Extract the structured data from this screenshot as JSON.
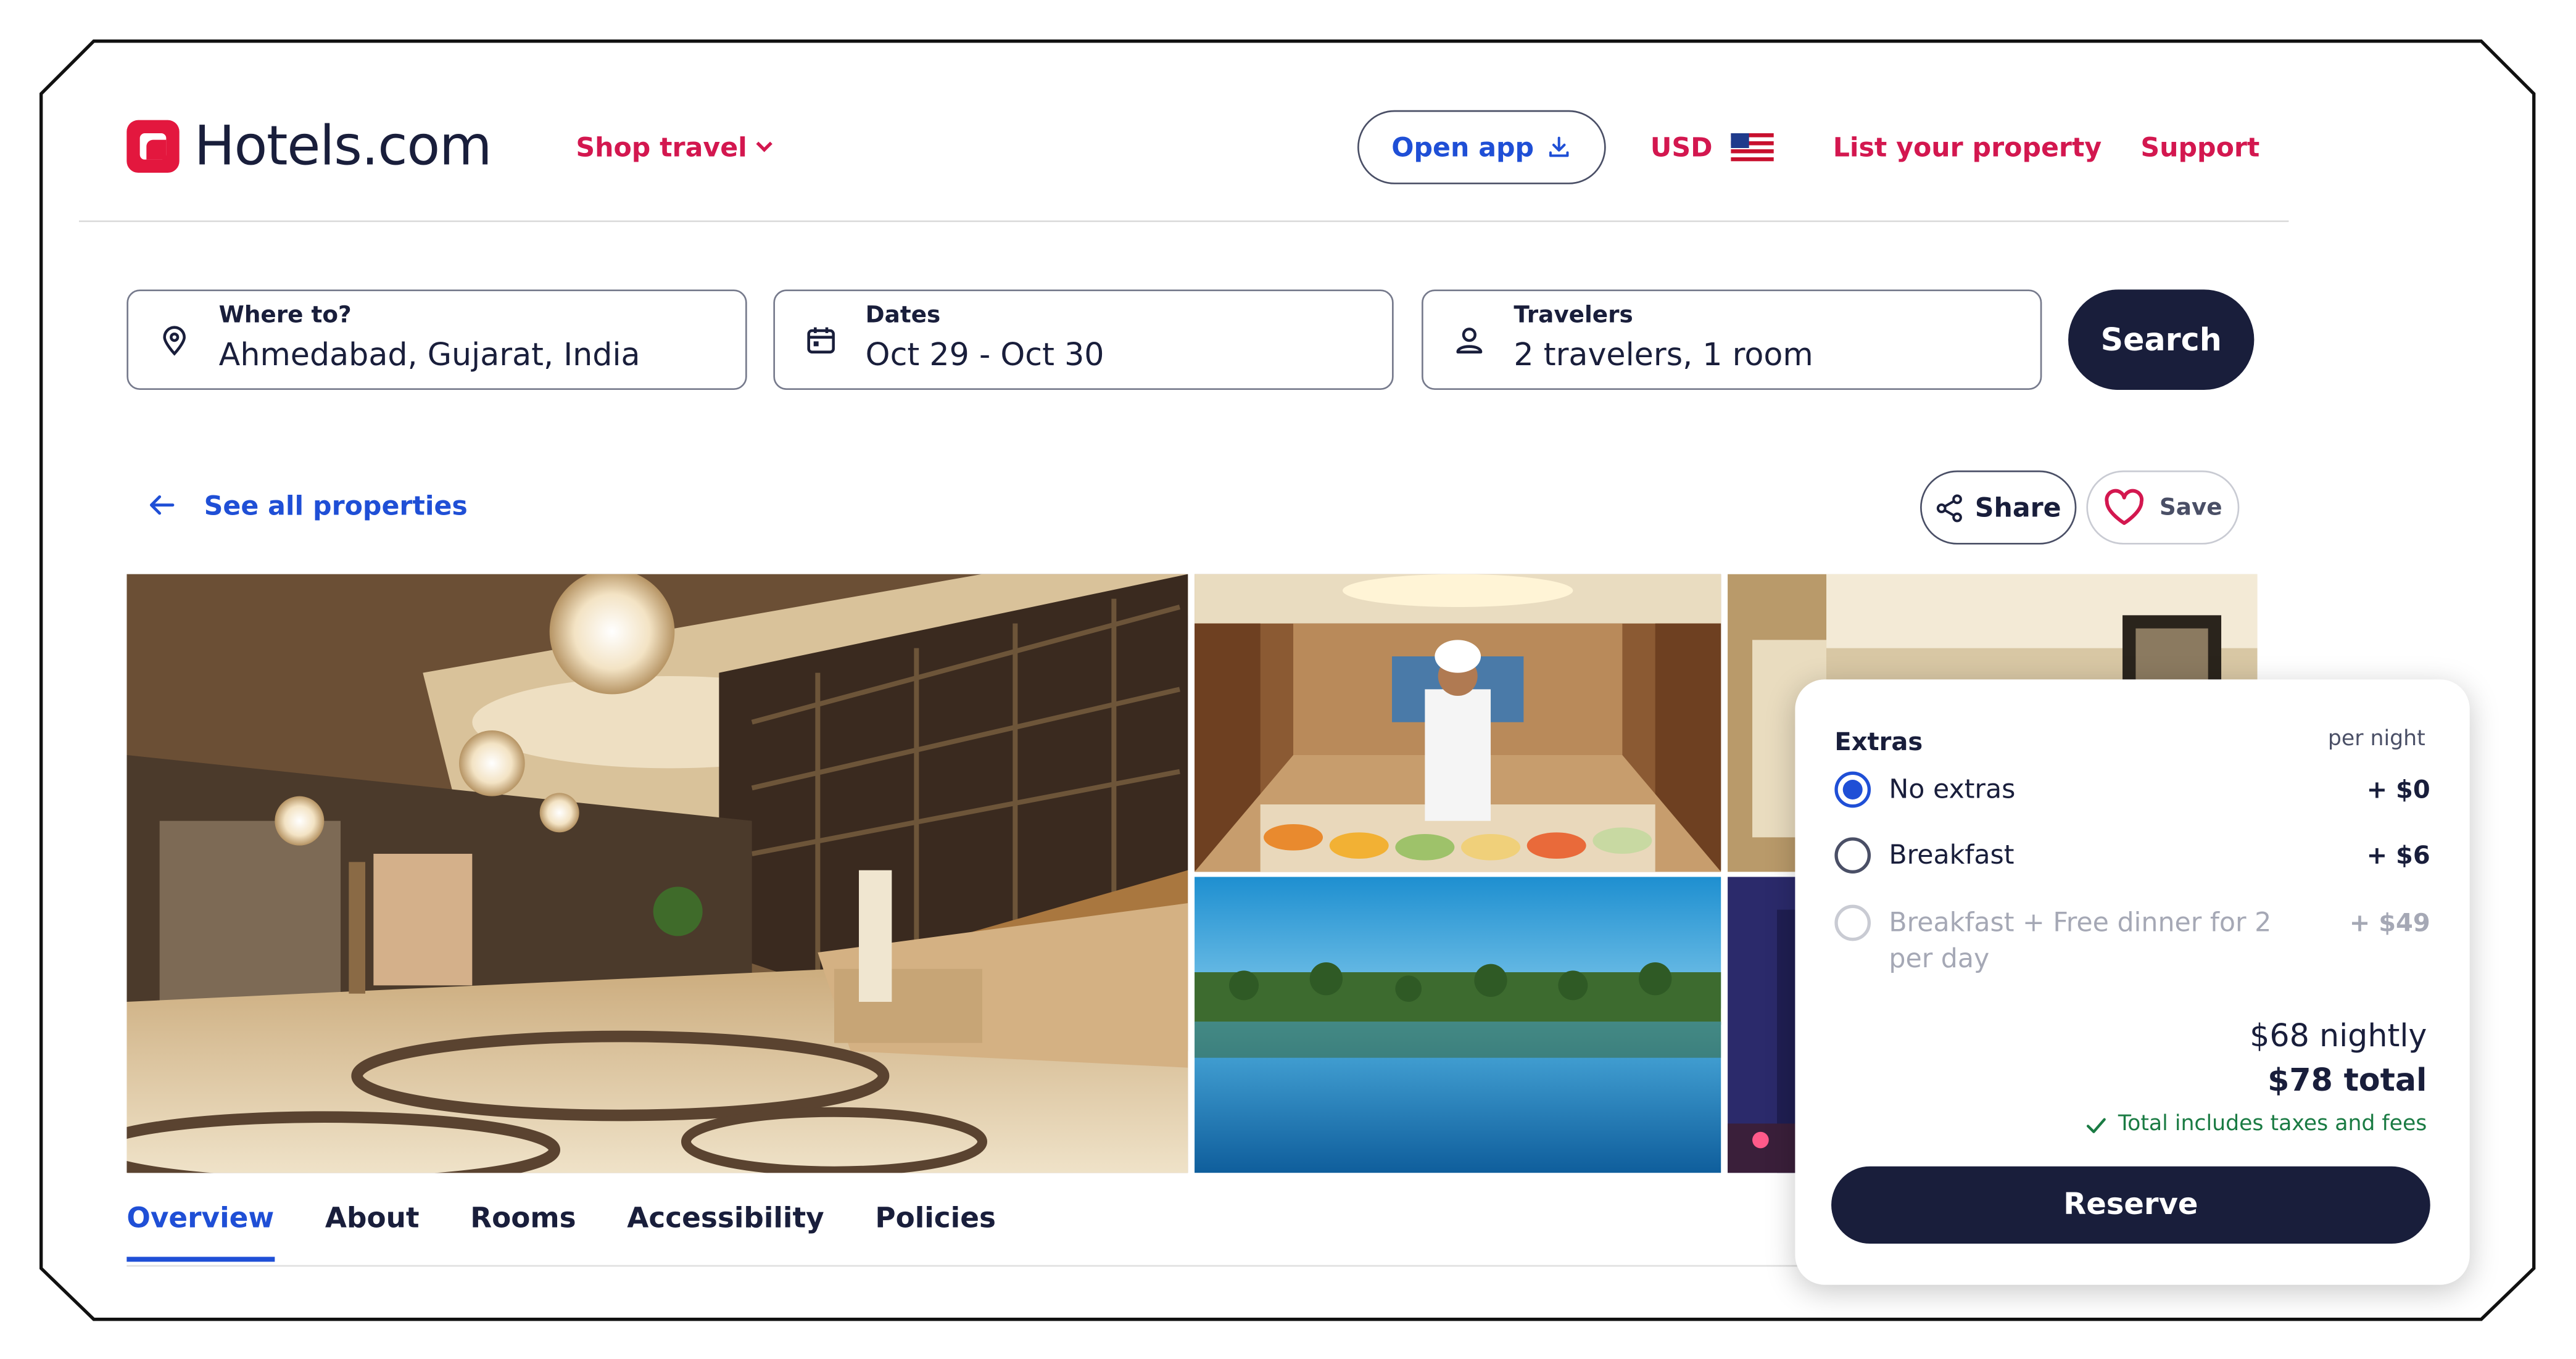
{
  "header": {
    "brand": "Hotels.com",
    "shop_travel": "Shop travel",
    "open_app": "Open app",
    "currency": "USD",
    "list_property": "List your property",
    "support": "Support"
  },
  "search": {
    "destination": {
      "label": "Where to?",
      "value": "Ahmedabad, Gujarat, India"
    },
    "dates": {
      "label": "Dates",
      "value": "Oct 29 - Oct 30"
    },
    "travelers": {
      "label": "Travelers",
      "value": "2 travelers, 1 room"
    },
    "button": "Search"
  },
  "actions": {
    "back": "See all properties",
    "share": "Share",
    "save": "Save"
  },
  "tabs": [
    "Overview",
    "About",
    "Rooms",
    "Accessibility",
    "Policies"
  ],
  "active_tab": "Overview",
  "extras": {
    "title": "Extras",
    "per_night": "per night",
    "options": [
      {
        "label": "No extras",
        "price": "+ $0",
        "selected": true,
        "enabled": true
      },
      {
        "label": "Breakfast",
        "price": "+ $6",
        "selected": false,
        "enabled": true
      },
      {
        "label": "Breakfast + Free dinner for 2 per day",
        "price": "+ $49",
        "selected": false,
        "enabled": false
      }
    ],
    "nightly": "$68 nightly",
    "total": "$78 total",
    "taxes_note": "Total includes taxes and fees",
    "reserve": "Reserve"
  },
  "colors": {
    "brand_red": "#e3173e",
    "link_red": "#d3174f",
    "link_blue": "#1f4fd6",
    "navy": "#191e3b",
    "success_green": "#1a7b43"
  },
  "icons": {
    "logo": "hotels-logo-icon",
    "chevron": "chevron-down-icon",
    "download": "download-icon",
    "flag": "us-flag-icon",
    "location": "map-pin-icon",
    "calendar": "calendar-icon",
    "person": "person-icon",
    "back": "arrow-left-icon",
    "share": "share-icon",
    "save": "heart-icon",
    "check": "check-icon"
  }
}
